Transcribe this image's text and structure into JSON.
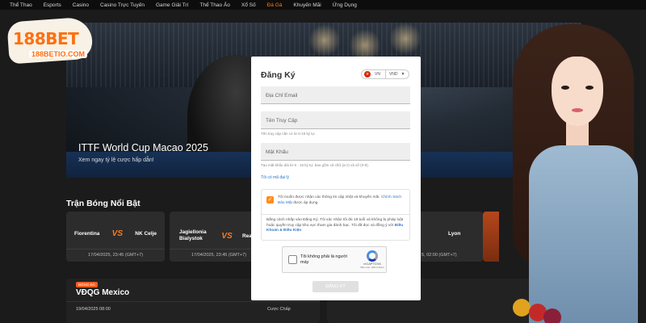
{
  "nav": {
    "items": [
      {
        "label": "Thể Thao",
        "active": false
      },
      {
        "label": "Esports",
        "active": false
      },
      {
        "label": "Casino",
        "active": false
      },
      {
        "label": "Casino Trực Tuyến",
        "active": false
      },
      {
        "label": "Game Giải Trí",
        "active": false
      },
      {
        "label": "Thể Thao Ảo",
        "active": false
      },
      {
        "label": "Xổ Số",
        "active": false
      },
      {
        "label": "Đá Gà",
        "active": true
      },
      {
        "label": "Khuyến Mãi",
        "active": false
      },
      {
        "label": "Ứng Dụng",
        "active": false
      }
    ]
  },
  "logo": {
    "word": "188BET",
    "domain": "188BETIO.COM"
  },
  "hero": {
    "title": "ITTF World Cup Macao 2025",
    "subtitle": "Xem ngay tỷ lệ cược hấp dẫn!"
  },
  "featured": {
    "heading": "Trận Bóng Nổi Bật",
    "vs_label": "VS",
    "matches": [
      {
        "home": "Fiorentina",
        "away": "NK Celje",
        "time": "17/04/2025, 23:45 (GMT+7)"
      },
      {
        "home": "Jagiellonia Bialystok",
        "away": "Real Bet",
        "time": "17/04/2025, 23:45 (GMT+7)"
      }
    ],
    "partial_match": {
      "away": "Lyon",
      "time": "5, 02:00 (GMT+7)"
    }
  },
  "league": {
    "badge": "BÓNG ĐÁ",
    "name": "VĐQG Mexico",
    "date": "19/04/2025 08:00",
    "column": "Cược Chấp"
  },
  "modal": {
    "title": "Đăng Ký",
    "language": {
      "code": "VN",
      "currency": "VND"
    },
    "email_placeholder": "Địa Chỉ Email",
    "username_placeholder": "Tên Truy Cập",
    "username_hint": "Tên truy cập cần có từ 6-15 ký tự.",
    "password_placeholder": "Mật Khẩu",
    "password_hint": "Tạo mật khẩu dài từ 6 - 15 ký tự, bao gồm cả chữ (a-z) và số (0-9).",
    "promo_link": "Tôi có mã đại lý",
    "consent_text": "Tôi muốn được nhận các thông tin cập nhật và khuyến mãi.",
    "consent_link": "Chính Sách Bảo Mật",
    "consent_suffix": "được áp dụng.",
    "terms_text": "Bằng cách nhấp vào Đăng Ký, Tôi xác nhận tôi đủ 18 tuổi và không bị pháp luật hoặc quyền truy cập khu vực tham gia đánh bạc. Tôi đã đọc và đồng ý với",
    "terms_link": "Điều Khoản & Điều Kiện",
    "captcha_label": "Tôi không phải là người máy",
    "captcha_brand": "reCAPTCHA",
    "captcha_privacy": "Bảo mật - Điều khoản",
    "submit_label": "ĐĂNG KÝ"
  },
  "colors": {
    "accent": "#ff7a1a",
    "link": "#2a74c8",
    "bg": "#1b1b1b"
  }
}
